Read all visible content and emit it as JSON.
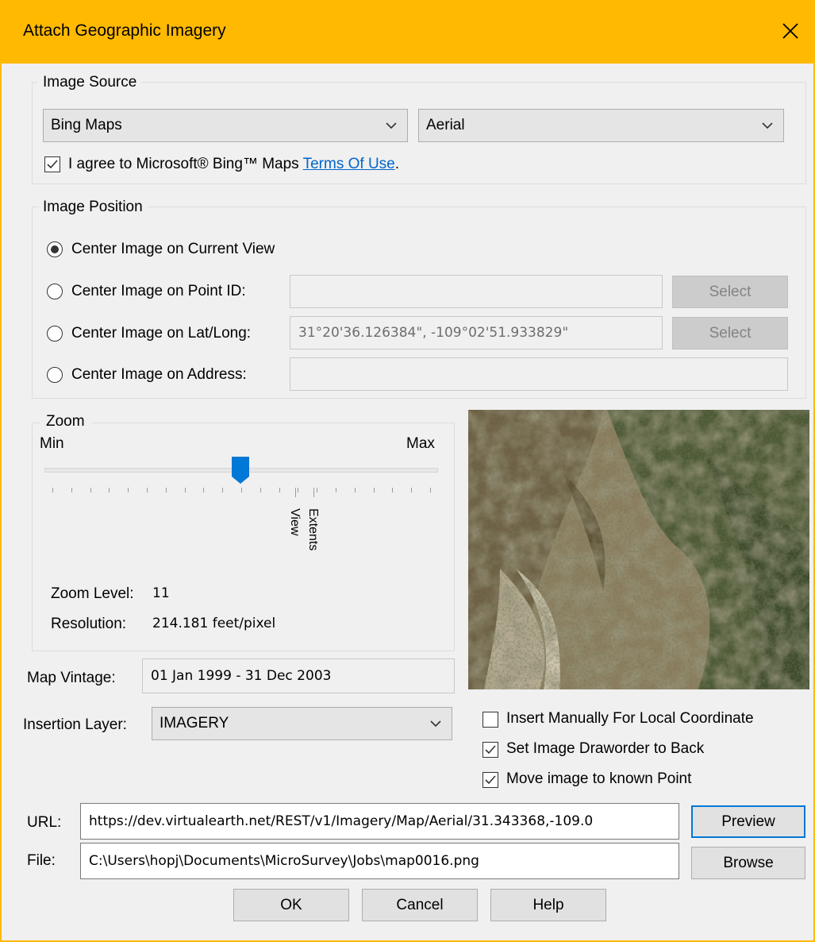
{
  "window": {
    "title": "Attach Geographic Imagery",
    "accent_color": "#ffb900",
    "close_icon": "close-icon"
  },
  "image_source": {
    "legend": "Image Source",
    "provider": "Bing Maps",
    "imagery_type": "Aerial",
    "agree_checked": true,
    "agree_text": "I agree to Microsoft® Bing™ Maps",
    "terms_link": "Terms Of Use",
    "agree_suffix": "."
  },
  "image_position": {
    "legend": "Image Position",
    "options": [
      {
        "label": "Center Image on Current View",
        "checked": true
      },
      {
        "label": "Center Image on Point ID:",
        "checked": false
      },
      {
        "label": "Center Image on Lat/Long:",
        "checked": false
      },
      {
        "label": "Center Image on Address:",
        "checked": false
      }
    ],
    "point_id_value": "",
    "latlong_value": "31°20'36.126384\", -109°02'51.933829\"",
    "address_value": "",
    "select_label": "Select"
  },
  "zoom": {
    "legend": "Zoom",
    "min_label": "Min",
    "max_label": "Max",
    "level_fraction": 0.5,
    "view_marker": "View",
    "extents_marker": "Extents",
    "zoom_level_label": "Zoom Level:",
    "zoom_level_value": "11",
    "resolution_label": "Resolution:",
    "resolution_value": "214.181 feet/pixel"
  },
  "map_vintage": {
    "label": "Map Vintage:",
    "value": "01 Jan 1999 - 31 Dec 2003"
  },
  "insertion_layer": {
    "label": "Insertion Layer:",
    "value": "IMAGERY"
  },
  "options": {
    "insert_manually": {
      "label": "Insert Manually For Local Coordinate",
      "checked": false
    },
    "drawoder_back": {
      "label": "Set Image Draworder to Back",
      "checked": true
    },
    "move_to_point": {
      "label": "Move image to known Point",
      "checked": true
    }
  },
  "url": {
    "label": "URL:",
    "value": "https://dev.virtualearth.net/REST/v1/Imagery/Map/Aerial/31.343368,-109.0"
  },
  "file": {
    "label": "File:",
    "value": "C:\\Users\\hopj\\Documents\\MicroSurvey\\Jobs\\map0016.png"
  },
  "buttons": {
    "preview": "Preview",
    "browse": "Browse",
    "ok": "OK",
    "cancel": "Cancel",
    "help": "Help"
  }
}
